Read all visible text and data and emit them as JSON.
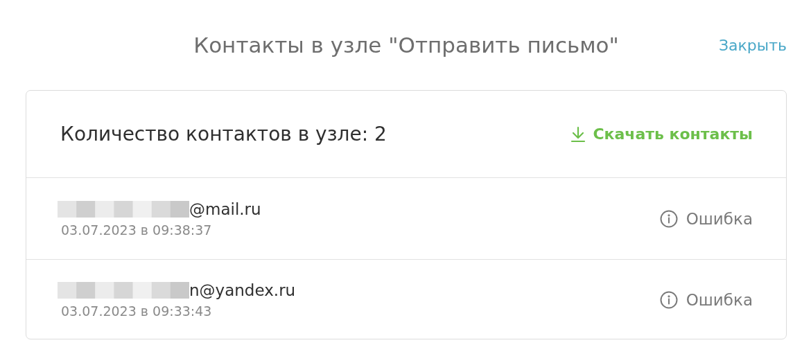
{
  "header": {
    "title": "Контакты в узле \"Отправить письмо\"",
    "close_link": "Закрыть"
  },
  "card": {
    "count_label": "Количество контактов в узле: 2",
    "download_link": "Скачать контакты",
    "contacts": [
      {
        "redacted": true,
        "email": "@mail.ru",
        "date": "03.07.2023 в 09:38:37",
        "status": "Ошибка"
      },
      {
        "redacted": true,
        "email": "n@yandex.ru",
        "date": "03.07.2023 в 09:33:43",
        "status": "Ошибка"
      }
    ]
  }
}
